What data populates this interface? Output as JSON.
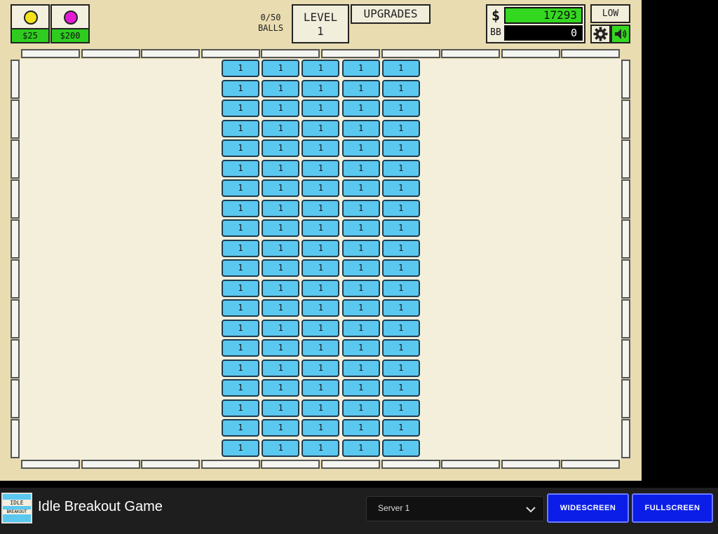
{
  "shop": {
    "balls": [
      {
        "price": "$25",
        "color": "#f4e21a"
      },
      {
        "price": "$200",
        "color": "#e41bd6"
      }
    ]
  },
  "header": {
    "balls_count": "0/50",
    "balls_label": "BALLS",
    "level_label": "LEVEL",
    "level_value": "1",
    "upgrades_label": "UPGRADES"
  },
  "stats": {
    "money_symbol": "$",
    "money_value": "17293",
    "bb_label": "BB",
    "bb_value": "0"
  },
  "settings": {
    "quality_label": "LOW"
  },
  "bricks": {
    "rows": 20,
    "cols": 5,
    "label": "1",
    "color": "#5bc8f0"
  },
  "footer": {
    "game_title": "Idle Breakout Game",
    "thumb_text_top": "IDLE",
    "thumb_text_bottom": "BREAKOUT",
    "server_selected": "Server 1",
    "widescreen_label": "WIDESCREEN",
    "fullscreen_label": "FULLSCREEN"
  }
}
